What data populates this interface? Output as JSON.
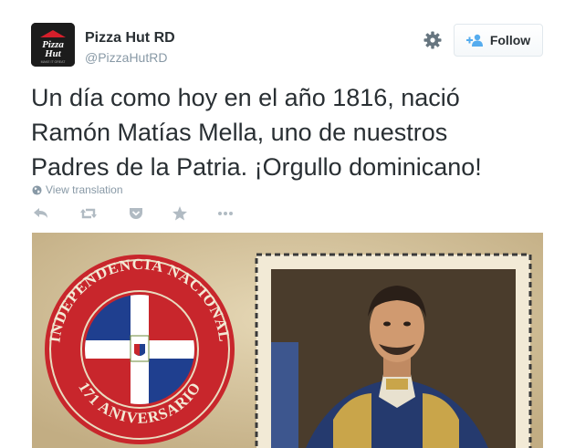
{
  "account": {
    "display_name": "Pizza Hut RD",
    "handle": "@PizzaHutRD",
    "avatar_logo_text": "Pizza Hut",
    "avatar_tagline": "MAKE IT GREAT"
  },
  "follow_button": {
    "label": "Follow",
    "icon": "add-user-icon"
  },
  "settings": {
    "icon": "gear-icon"
  },
  "tweet": {
    "text": "Un día como hoy en el año 1816, nació\nRamón Matías Mella, uno de nuestros\nPadres de la Patria. ¡Orgullo dominicano!"
  },
  "translation": {
    "label": "View translation",
    "icon": "globe-icon"
  },
  "actions": [
    {
      "name": "reply",
      "icon": "reply-icon"
    },
    {
      "name": "retweet",
      "icon": "retweet-icon"
    },
    {
      "name": "save",
      "icon": "pocket-icon"
    },
    {
      "name": "favorite",
      "icon": "star-icon"
    },
    {
      "name": "more",
      "icon": "more-icon"
    }
  ],
  "media": {
    "seal_top_text": "INDEPENDENCIA NACIONAL",
    "seal_left_text": "INDEPENDENCIA",
    "seal_bottom_text": "171 ANIVERSARIO",
    "colors": {
      "parchment": "#d6c5a1",
      "seal_red": "#c8262c",
      "flag_blue": "#1f3f8f",
      "flag_red": "#c8262c"
    }
  }
}
